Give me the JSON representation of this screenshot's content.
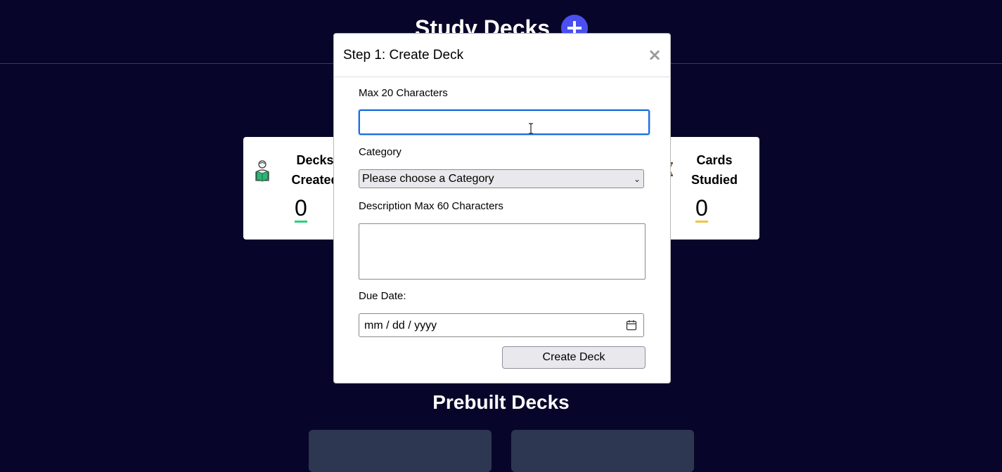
{
  "header": {
    "title": "Study Decks",
    "add_icon": "plus-icon"
  },
  "stats": {
    "decks_created": {
      "label": "Decks Created",
      "value": "0",
      "icon": "reading-person-icon",
      "accent": "#2bd07a"
    },
    "cards_studied": {
      "label": "Cards Studied",
      "value": "0",
      "icon": "hourglass-icon",
      "accent": "#f3c33d"
    }
  },
  "prebuilt": {
    "title": "Prebuilt Decks"
  },
  "modal": {
    "title": "Step 1: Create Deck",
    "close_label": "×",
    "name_label": "Max 20 Characters",
    "name_value": "",
    "category_label": "Category",
    "category_selected": "Please choose a Category",
    "description_label": "Description Max 60 Characters",
    "description_value": "",
    "due_date_label": "Due Date:",
    "due_date_placeholder": "mm / dd / yyyy",
    "submit_label": "Create Deck"
  },
  "colors": {
    "background": "#07062a",
    "accent_blue": "#4a4ff0",
    "focus_border": "#1b6fe0",
    "prebuilt_card": "#2e3752"
  }
}
